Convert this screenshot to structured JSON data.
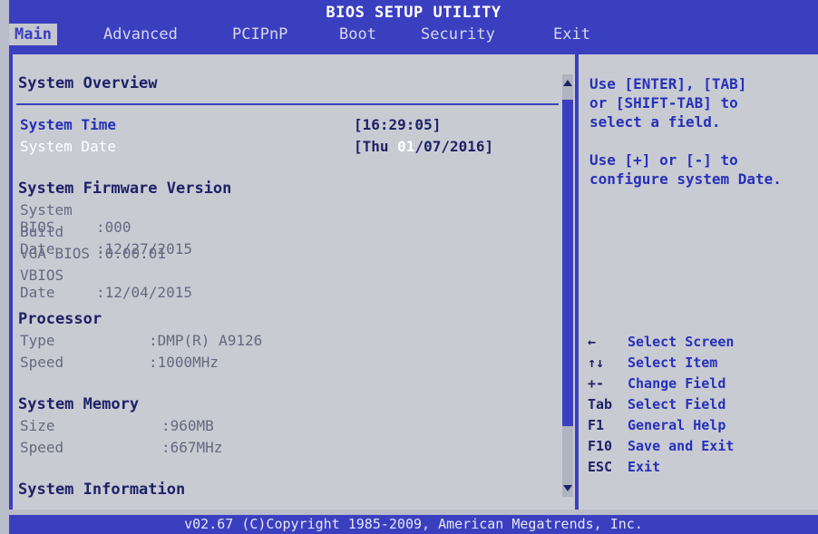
{
  "title": "BIOS SETUP UTILITY",
  "tabs": [
    "Main",
    "Advanced",
    "PCIPnP",
    "Boot",
    "Security",
    "Exit"
  ],
  "overview": {
    "heading": "System Overview",
    "system_time_label": "System Time",
    "system_time_value": "[16:29:05]",
    "system_date_label": "System Date",
    "system_date_prefix": "[Thu ",
    "system_date_highlight": "01",
    "system_date_suffix": "/07/2016]"
  },
  "firmware": {
    "heading": "System Firmware Version",
    "rows": [
      {
        "label": "System BIOS",
        "value": ":000"
      },
      {
        "label": "Build Date",
        "value": ":12/27/2015"
      },
      {
        "label": "VGA BIOS",
        "value": ":0.00.01"
      },
      {
        "label": "VBIOS Date",
        "value": ":12/04/2015"
      }
    ]
  },
  "processor": {
    "heading": "Processor",
    "rows": [
      {
        "label": "Type",
        "value": ":DMP(R) A9126"
      },
      {
        "label": "Speed",
        "value": ":1000MHz"
      }
    ]
  },
  "memory": {
    "heading": "System Memory",
    "rows": [
      {
        "label": "Size",
        "value": ":960MB"
      },
      {
        "label": "Speed",
        "value": ":667MHz"
      }
    ]
  },
  "info_heading": "System Information",
  "help": {
    "lines": [
      "Use [ENTER], [TAB]",
      "or [SHIFT-TAB] to",
      "select a field.",
      "",
      "Use [+] or [-] to",
      "configure system Date."
    ]
  },
  "keys": [
    {
      "key": "←",
      "desc": "Select Screen"
    },
    {
      "key": "↑↓",
      "desc": "Select Item"
    },
    {
      "key": "+-",
      "desc": "Change Field"
    },
    {
      "key": "Tab",
      "desc": "Select Field"
    },
    {
      "key": "F1",
      "desc": "General Help"
    },
    {
      "key": "F10",
      "desc": "Save and Exit"
    },
    {
      "key": "ESC",
      "desc": "Exit"
    }
  ],
  "footer": "v02.67 (C)Copyright 1985-2009, American Megatrends, Inc."
}
